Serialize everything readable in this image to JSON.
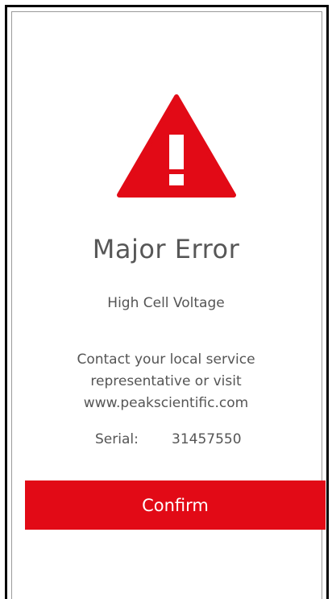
{
  "dialog": {
    "icon": "warning-triangle-icon",
    "title": "Major Error",
    "subtitle": "High Cell Voltage",
    "contact_lines": [
      "Contact your local service",
      "representative or visit",
      "www.peakscientific.com"
    ],
    "serial_label": "Serial:",
    "serial_value": "31457550",
    "confirm_label": "Confirm"
  },
  "colors": {
    "accent_red": "#e20a16",
    "text_gray": "#555555",
    "title_gray": "#575757"
  }
}
